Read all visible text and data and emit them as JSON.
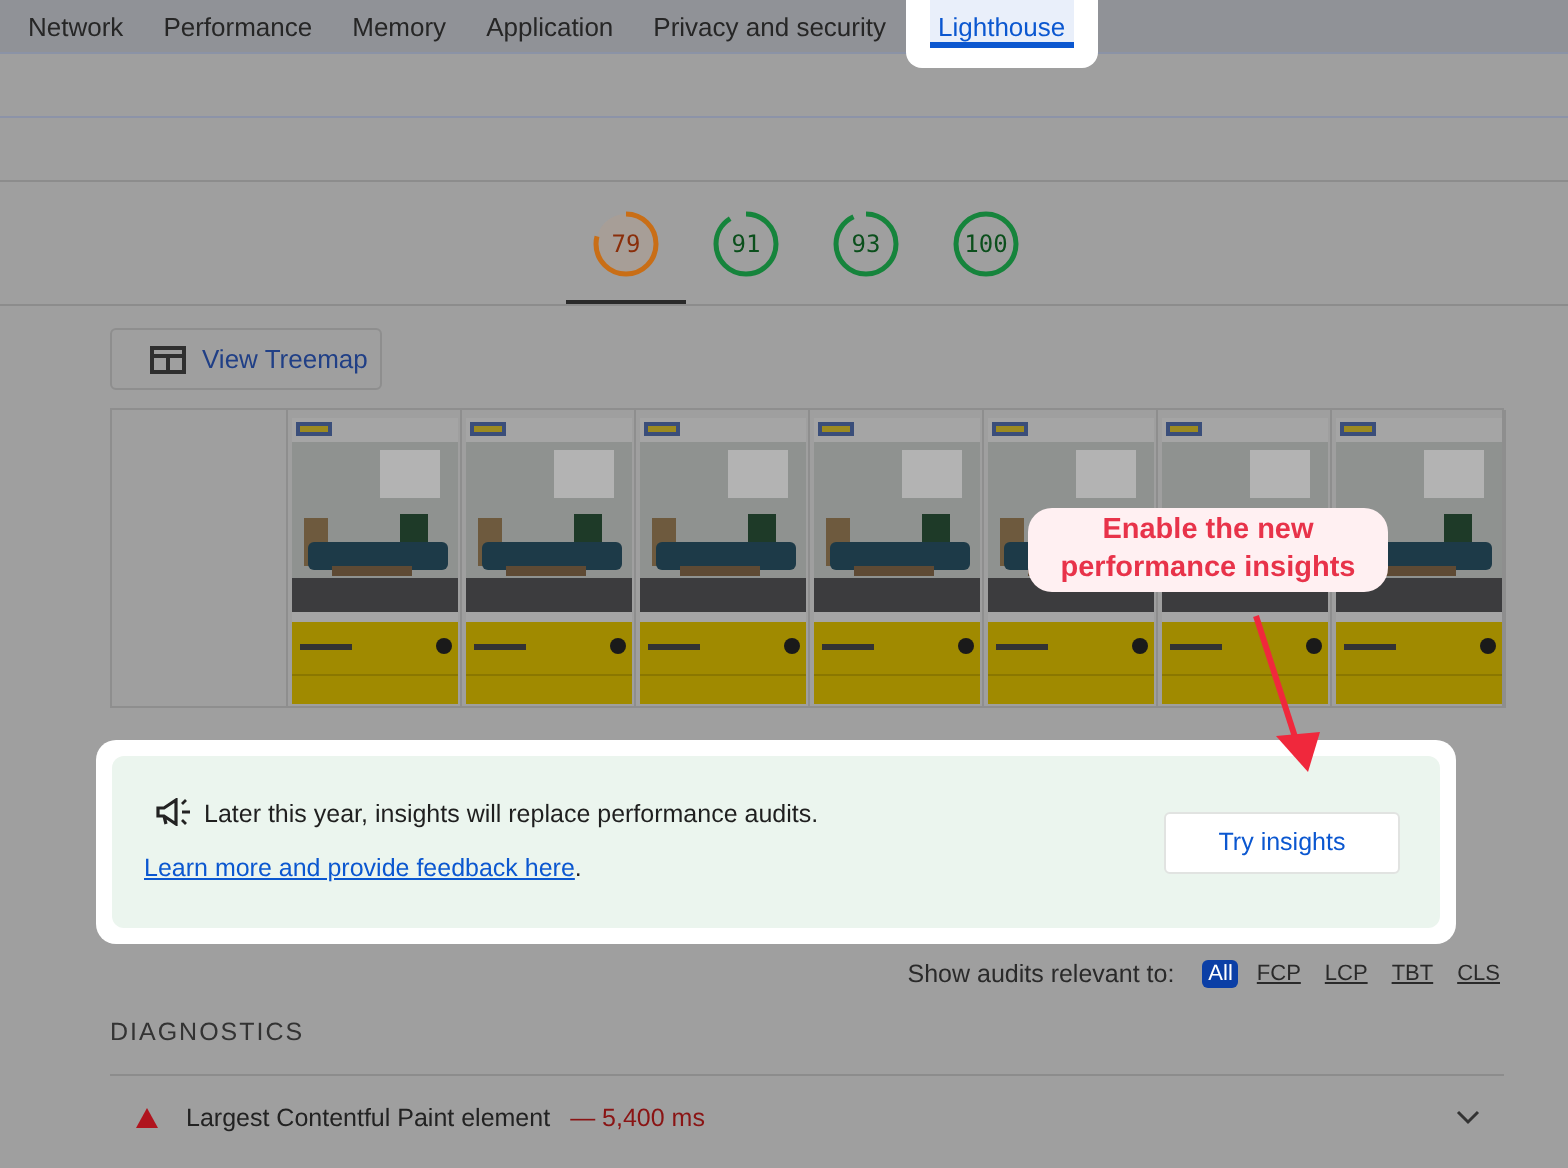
{
  "tabs": [
    {
      "label": "Network",
      "selected": false
    },
    {
      "label": "Performance",
      "selected": false
    },
    {
      "label": "Memory",
      "selected": false
    },
    {
      "label": "Application",
      "selected": false
    },
    {
      "label": "Privacy and security",
      "selected": false
    },
    {
      "label": "Lighthouse",
      "selected": true
    }
  ],
  "scores": [
    {
      "value": "79",
      "level": 0.79,
      "kind": "average",
      "selected": true
    },
    {
      "value": "91",
      "level": 0.91,
      "kind": "pass",
      "selected": false
    },
    {
      "value": "93",
      "level": 0.93,
      "kind": "pass",
      "selected": false
    },
    {
      "value": "100",
      "level": 1,
      "kind": "pass",
      "selected": false
    }
  ],
  "treemap_button": {
    "label": "View Treemap"
  },
  "filmstrip": [
    {
      "kind": "blank"
    },
    {
      "kind": "picture"
    },
    {
      "kind": "picture"
    },
    {
      "kind": "picture"
    },
    {
      "kind": "picture"
    },
    {
      "kind": "picture"
    },
    {
      "kind": "picture"
    },
    {
      "kind": "picture"
    }
  ],
  "banner": {
    "text": "Later this year, insights will replace performance audits.",
    "link": "Learn more and provide feedback here",
    "end": ".",
    "button": "Try insights"
  },
  "filter": {
    "label": "Show audits relevant to:",
    "options": [
      {
        "label": "All",
        "selected": true
      },
      {
        "label": "FCP",
        "selected": false
      },
      {
        "label": "LCP",
        "selected": false
      },
      {
        "label": "TBT",
        "selected": false
      },
      {
        "label": "CLS",
        "selected": false
      }
    ]
  },
  "section": {
    "title": "DIAGNOSTICS"
  },
  "audits": [
    {
      "title": "Largest Contentful Paint element",
      "value": "— 5,400 ms",
      "kind": "fail",
      "expanded": false
    }
  ],
  "annotation": {
    "text": "Enable the new performance insights"
  }
}
